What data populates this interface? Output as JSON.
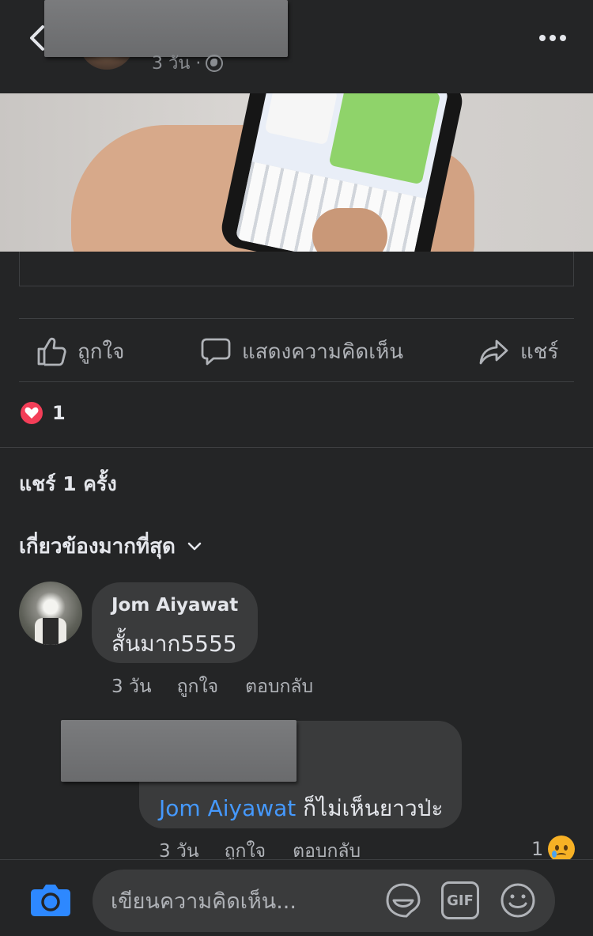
{
  "header": {
    "post_time": "3 วัน ·",
    "back_icon": "chevron-left-icon",
    "more_icon": "more-horizontal-icon",
    "privacy_icon": "globe-icon"
  },
  "actions": {
    "like_label": "ถูกใจ",
    "comment_label": "แสดงความคิดเห็น",
    "share_label": "แชร์"
  },
  "reactions": {
    "icon": "heart-reaction-icon",
    "count": "1"
  },
  "shares_text": "แชร์ 1 ครั้ง",
  "sort": {
    "label": "เกี่ยวข้องมากที่สุด",
    "icon": "chevron-down-icon"
  },
  "comments": [
    {
      "author": "Jom Aiyawat",
      "text": "สั้นมาก5555",
      "time": "3 วัน",
      "like_label": "ถูกใจ",
      "reply_label": "ตอบกลับ"
    }
  ],
  "reply": {
    "mention": "Jom Aiyawat",
    "text": " ก็ไม่เห็นยาวป่ะ",
    "time": "3 วัน",
    "like_label": "ถูกใจ",
    "reply_label": "ตอบกลับ",
    "reaction_count": "1",
    "reaction_icon": "sad-reaction-icon"
  },
  "composer": {
    "placeholder": "เขียนความคิดเห็น...",
    "gif_label": "GIF",
    "camera_icon": "camera-icon",
    "sticker_icon": "sticker-icon",
    "emoji_icon": "emoji-icon"
  },
  "colors": {
    "background": "#242526",
    "bubble": "#3a3b3c",
    "mention": "#4599ff",
    "camera_blue": "#2d88ff",
    "heart": "#f33e58"
  }
}
